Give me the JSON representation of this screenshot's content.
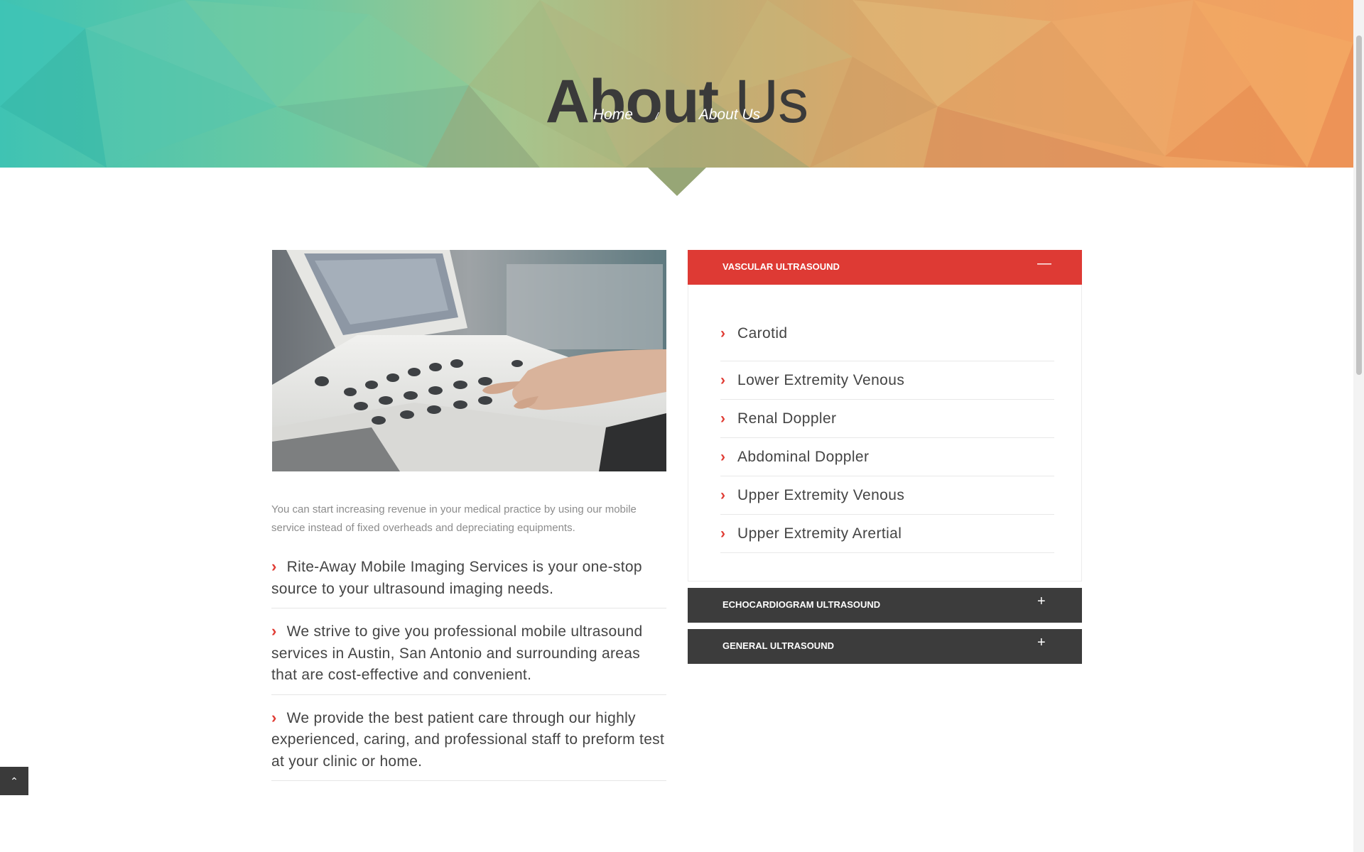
{
  "hero": {
    "title_bold": "About",
    "title_light": "Us",
    "breadcrumb": {
      "home": "Home",
      "separator": "/",
      "current": "About Us"
    }
  },
  "intro_text": "You can start increasing revenue in your medical practice by using our mobile service instead of fixed overheads and depreciating equipments.",
  "features": [
    "Rite-Away Mobile Imaging Services is your one-stop source to your ultrasound imaging needs.",
    "We strive to give you professional mobile ultrasound services in Austin, San Antonio and surrounding areas that are cost-effective and convenient.",
    "We provide the best patient care through our highly experienced, caring, and professional staff to preform test at your clinic or home."
  ],
  "accordion": {
    "sections": [
      {
        "title": "VASCULAR ULTRASOUND",
        "toggle": "—",
        "expanded": true
      },
      {
        "title": "ECHOCARDIOGRAM ULTRASOUND",
        "toggle": "+",
        "expanded": false
      },
      {
        "title": "GENERAL ULTRASOUND",
        "toggle": "+",
        "expanded": false
      }
    ],
    "vascular_items": [
      "Carotid",
      "Lower Extremity Venous",
      "Renal Doppler",
      "Abdominal Doppler",
      "Upper Extremity Venous",
      "Upper Extremity Arertial"
    ]
  },
  "icons": {
    "list_bullet": "chevron-right-icon",
    "back_to_top": "chevron-up-icon"
  },
  "colors": {
    "accent_red": "#de3a34",
    "dark_panel": "#3c3c3c",
    "title_text": "#3a3a3a"
  }
}
